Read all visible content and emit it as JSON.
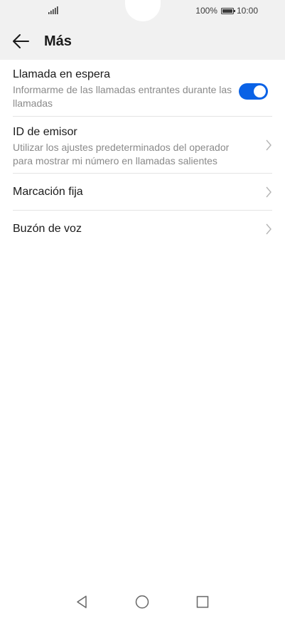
{
  "status_bar": {
    "battery_text": "100%",
    "time": "10:00",
    "icons": [
      "signal-icon",
      "battery-icon"
    ]
  },
  "header": {
    "title": "Más",
    "back_icon": "back-arrow-icon"
  },
  "settings": [
    {
      "title": "Llamada en espera",
      "subtitle": "Informarme de las llamadas entrantes durante las llamadas",
      "control": "toggle",
      "toggle_on": true
    },
    {
      "title": "ID de emisor",
      "subtitle": "Utilizar los ajustes predeterminados del operador para mostrar mi número en llamadas salientes",
      "control": "chevron"
    },
    {
      "title": "Marcación fija",
      "subtitle": "",
      "control": "chevron"
    },
    {
      "title": "Buzón de voz",
      "subtitle": "",
      "control": "chevron"
    }
  ],
  "nav_bar": {
    "icons": [
      "nav-back-icon",
      "nav-home-icon",
      "nav-recents-icon"
    ]
  },
  "colors": {
    "accent": "#0a62e6",
    "header_bg": "#f1f1f1",
    "subtitle": "#8a8a8a",
    "divider": "#e4e4e4"
  }
}
